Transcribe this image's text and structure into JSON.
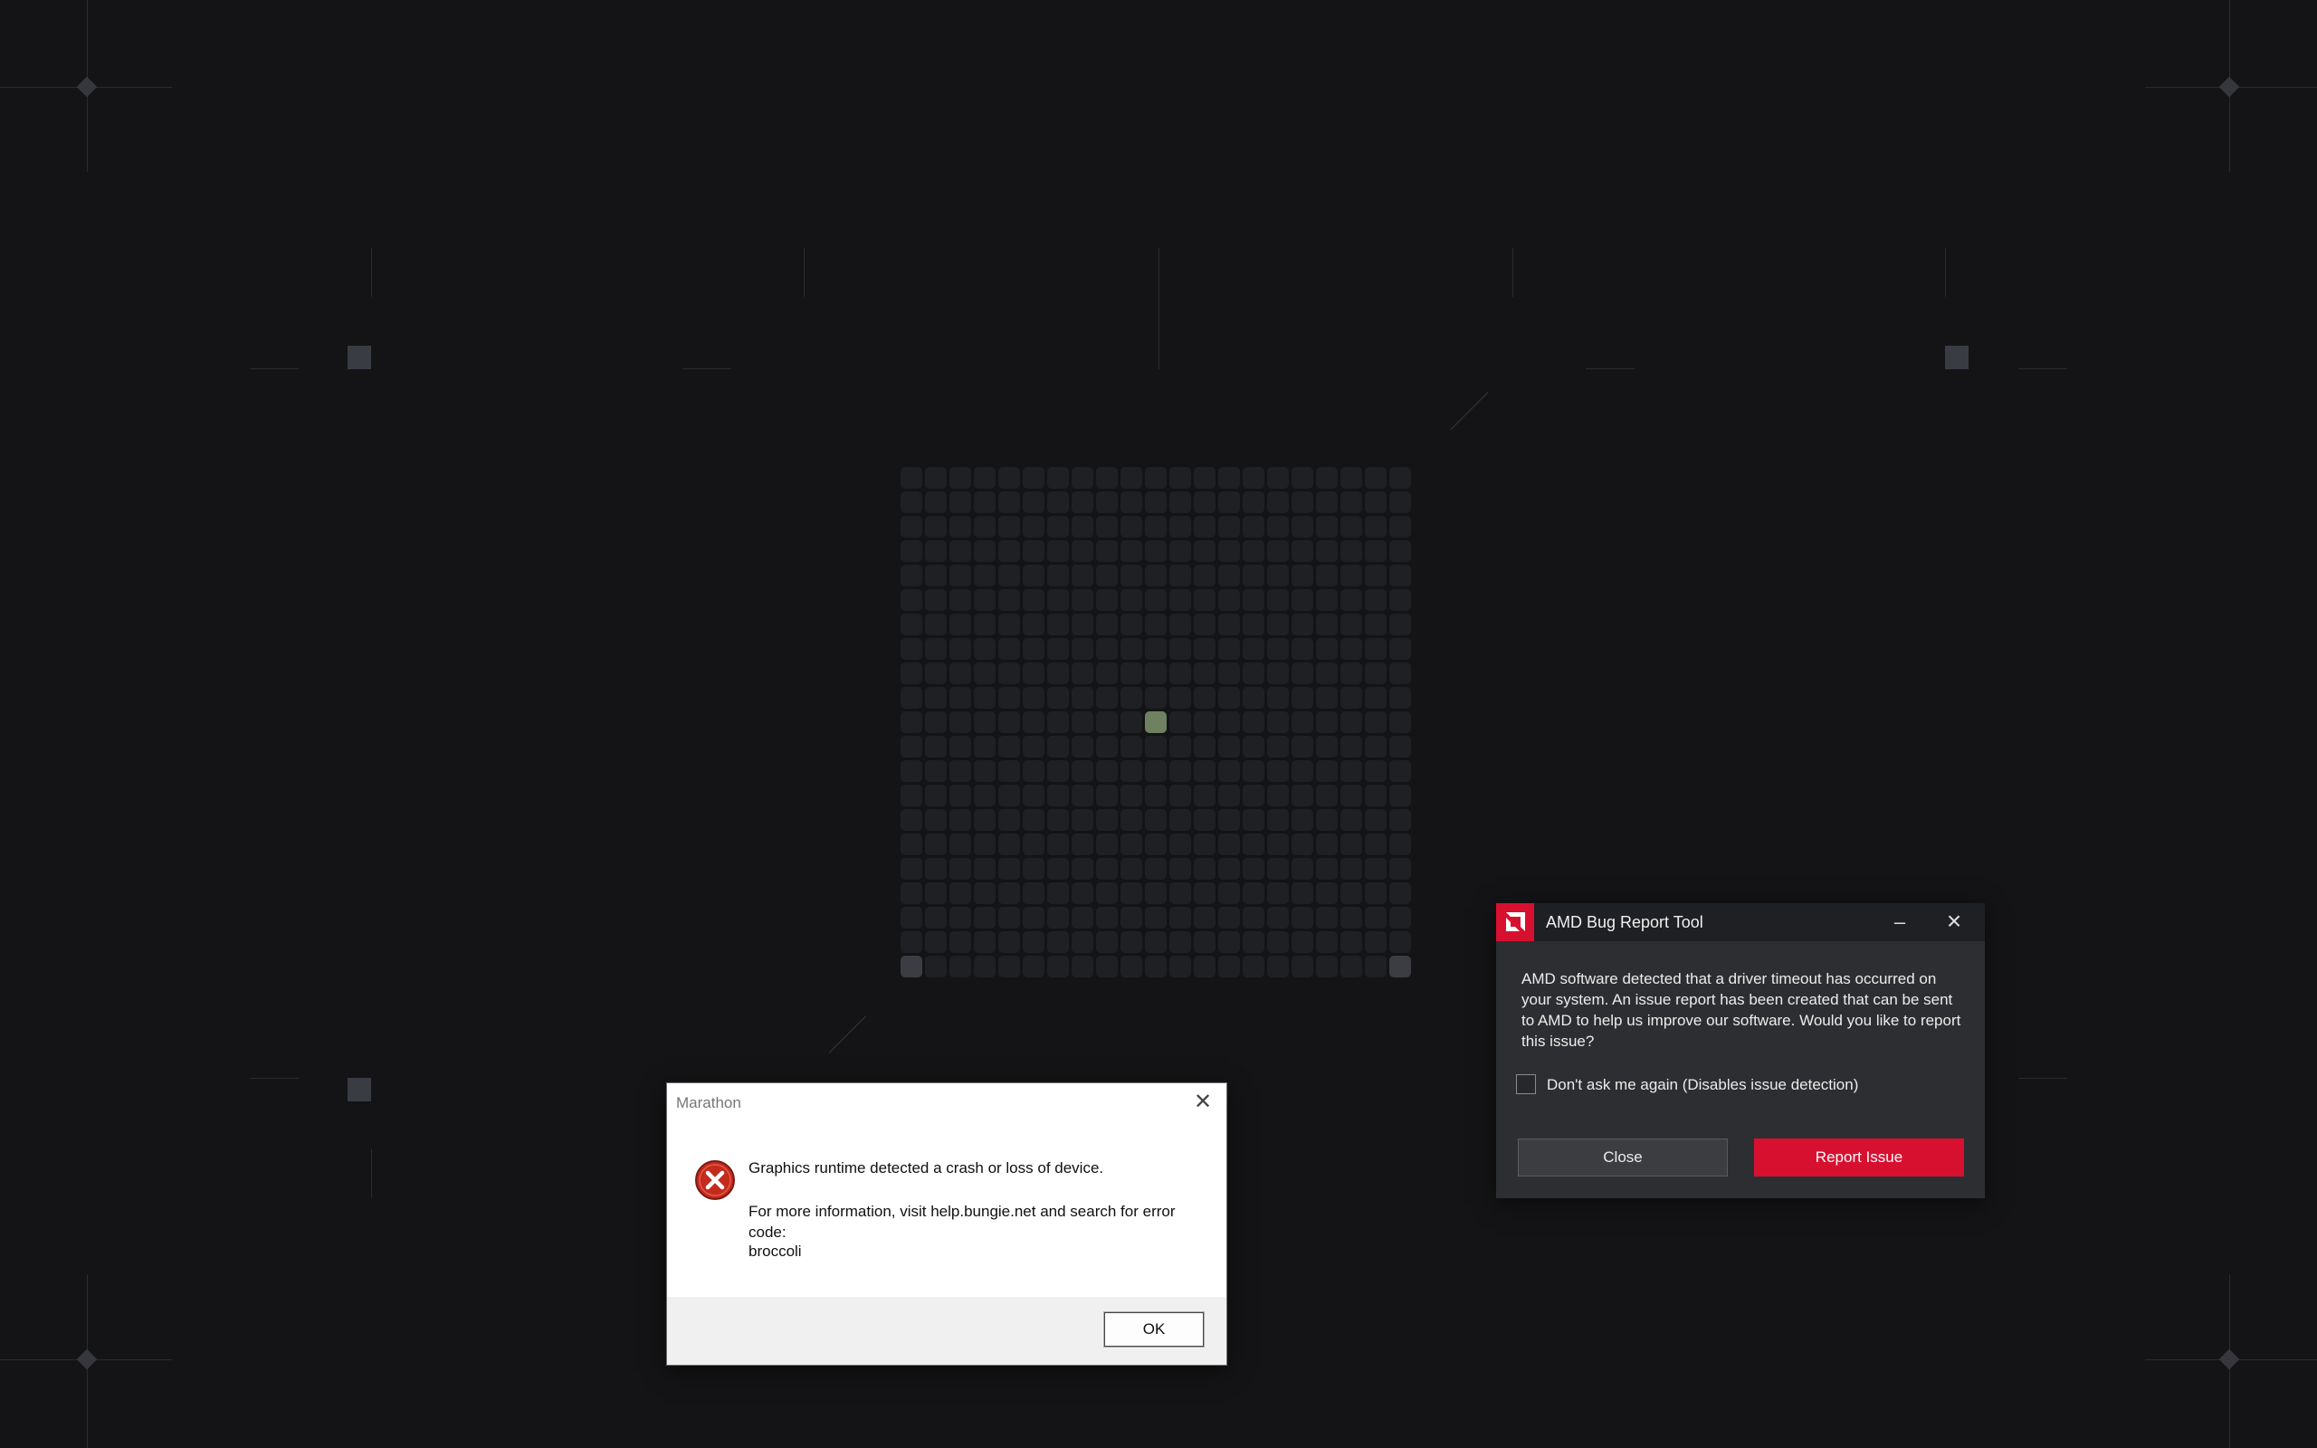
{
  "background": {
    "color": "#141416",
    "grid_active_color": "#6f8160"
  },
  "marathon_dialog": {
    "title": "Marathon",
    "message_line1": "Graphics runtime detected a crash or loss of device.",
    "message_line2": "For more information, visit help.bungie.net and search for error code:",
    "error_code": "broccoli",
    "ok_label": "OK",
    "icon": "error-x-icon"
  },
  "amd_dialog": {
    "title": "AMD Bug Report Tool",
    "message": "AMD software detected that a driver timeout has occurred on your system. An issue report has been created that can be sent to AMD to help us improve our software. Would you like to report this issue?",
    "checkbox_label": "Don't ask me again (Disables issue detection)",
    "checkbox_checked": false,
    "close_label": "Close",
    "report_label": "Report Issue",
    "accent_color": "#d8102f",
    "icons": {
      "logo": "amd-logo-icon",
      "minimize": "minimize-icon",
      "close": "close-icon"
    }
  }
}
